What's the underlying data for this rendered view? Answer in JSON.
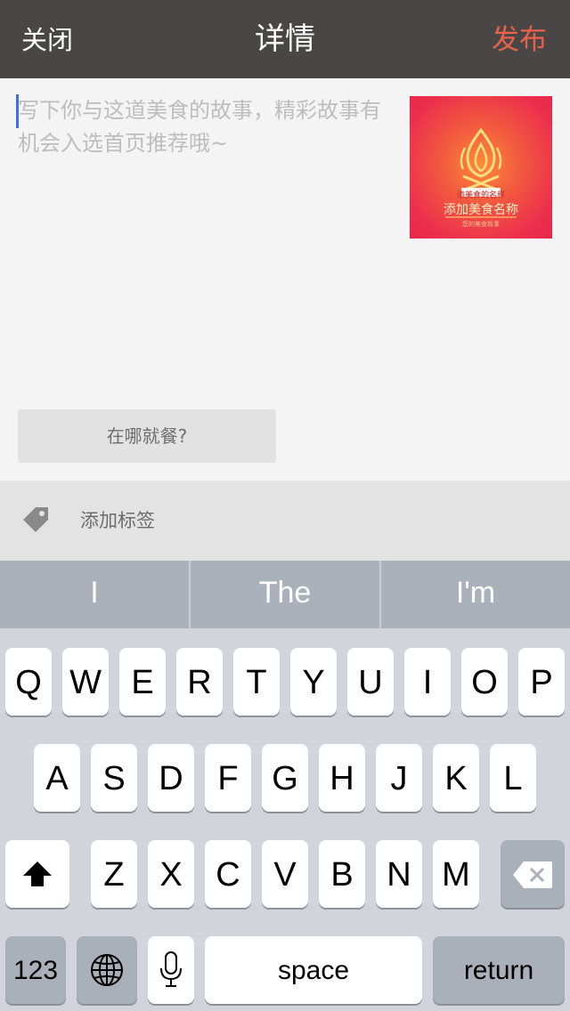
{
  "navbar": {
    "close_label": "关闭",
    "title": "详情",
    "publish_label": "发布"
  },
  "compose": {
    "placeholder": "写下你与这道美食的故事，精彩故事有机会入选首页推荐哦~",
    "cover": {
      "subtitle": "添美食的名称",
      "name": "添加美食名称",
      "footer": "您的美食故事"
    },
    "where_label": "在哪就餐?"
  },
  "tag_row": {
    "icon": "tag-icon",
    "label": "添加标签"
  },
  "keyboard": {
    "suggestions": [
      "I",
      "The",
      "I'm"
    ],
    "row1": [
      "Q",
      "W",
      "E",
      "R",
      "T",
      "Y",
      "U",
      "I",
      "O",
      "P"
    ],
    "row2": [
      "A",
      "S",
      "D",
      "F",
      "G",
      "H",
      "J",
      "K",
      "L"
    ],
    "row3": [
      "Z",
      "X",
      "C",
      "V",
      "B",
      "N",
      "M"
    ],
    "numbers_label": "123",
    "space_label": "space",
    "return_label": "return",
    "icons": {
      "shift": "shift-icon",
      "delete": "delete-icon",
      "globe": "globe-icon",
      "mic": "microphone-icon"
    }
  },
  "colors": {
    "navbar_bg": "#4a4646",
    "publish": "#e8624a",
    "cursor": "#3f6fe8",
    "cover_red": "#ec2f4d"
  }
}
